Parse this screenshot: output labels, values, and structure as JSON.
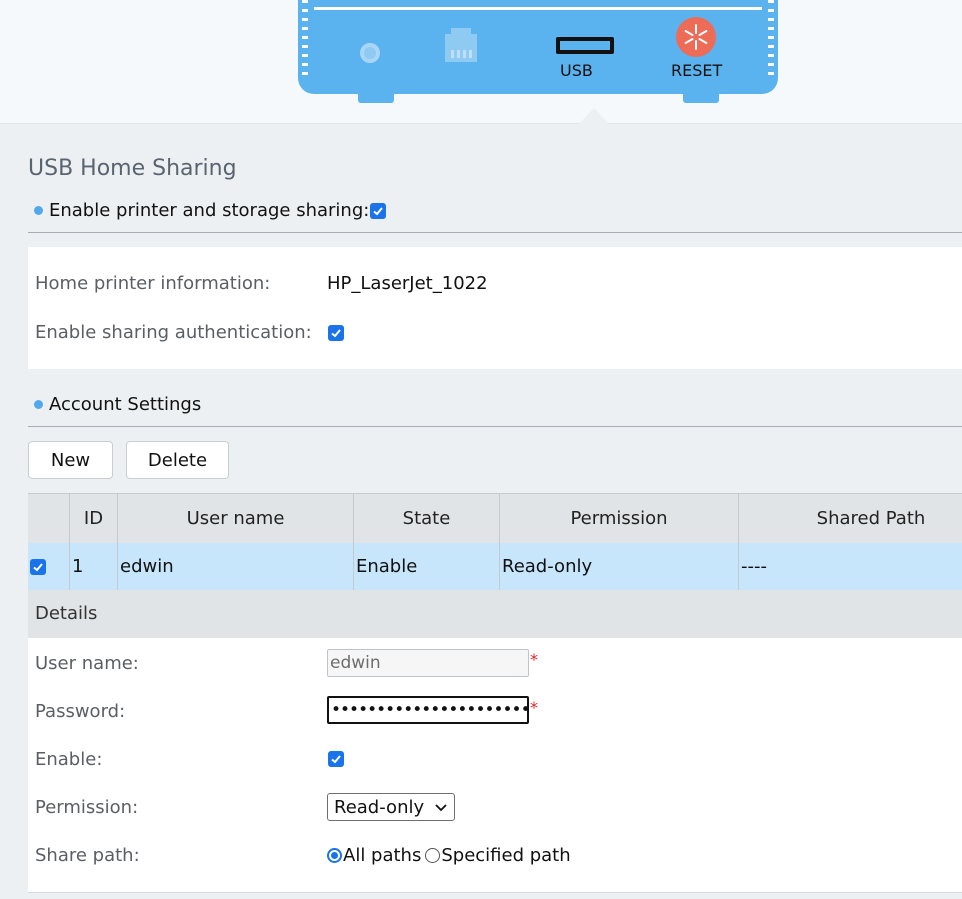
{
  "device": {
    "usb_label": "USB",
    "reset_label": "RESET"
  },
  "page": {
    "title": "USB Home Sharing"
  },
  "sharing": {
    "enable_label": "Enable printer and storage sharing:",
    "enable_checked": true,
    "printer_info_label": "Home printer information:",
    "printer_info_value": "HP_LaserJet_1022",
    "auth_label": "Enable sharing authentication:",
    "auth_checked": true
  },
  "accounts": {
    "section_label": "Account Settings",
    "new_label": "New",
    "delete_label": "Delete",
    "columns": [
      "ID",
      "User name",
      "State",
      "Permission",
      "Shared Path"
    ],
    "rows": [
      {
        "selected": true,
        "id": "1",
        "user": "edwin",
        "state": "Enable",
        "permission": "Read-only",
        "path": "----"
      }
    ]
  },
  "details": {
    "title": "Details",
    "username_label": "User name:",
    "username_value": "edwin",
    "password_label": "Password:",
    "password_value": "•••••••••••••••••••••••••",
    "required_mark": "*",
    "enable_label": "Enable:",
    "enable_checked": true,
    "permission_label": "Permission:",
    "permission_value": "Read-only",
    "sharepath_label": "Share path:",
    "sharepath_option_all": "All paths",
    "sharepath_option_specified": "Specified path",
    "sharepath_selected": "All paths"
  },
  "colors": {
    "device_blue": "#5ab2ee",
    "reset_red": "#ee6b57",
    "accent_blue": "#1a73e8",
    "selected_row": "#c7e6fb",
    "required_red": "#e0232e"
  }
}
